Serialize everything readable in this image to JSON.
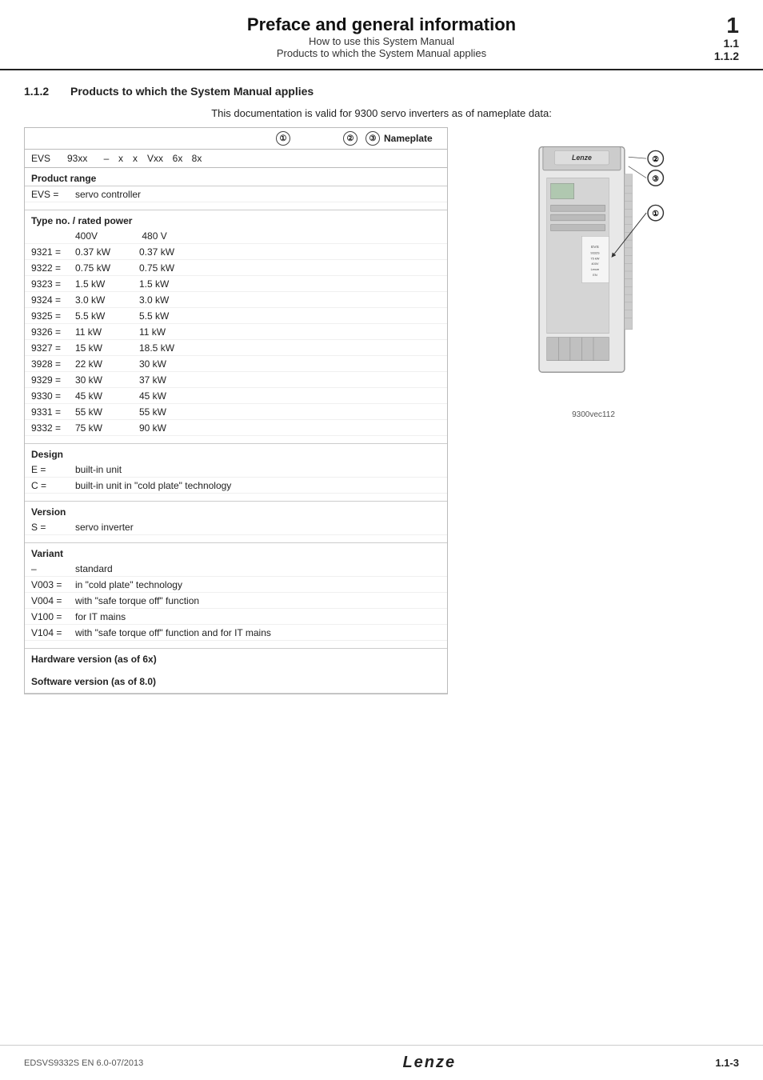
{
  "header": {
    "main_title": "Preface and general information",
    "sub1": "How to use this System Manual",
    "sub2": "Products to which the System Manual applies",
    "num_main": "1",
    "num_sub1": "1.1",
    "num_sub2": "1.1.2"
  },
  "section": {
    "number": "1.1.2",
    "title": "Products to which the System Manual applies",
    "description": "This documentation is valid for 9300 servo inverters as of nameplate data:"
  },
  "table": {
    "col_headers": {
      "circle1": "①",
      "circle2": "②",
      "circle3": "③",
      "nameplate": "Nameplate"
    },
    "evs_row": {
      "label": "EVS",
      "code93": "93xx",
      "dash": "–",
      "x1": "x",
      "x2": "x",
      "vxx": "Vxx",
      "num6x": "6x",
      "num8x": "8x"
    },
    "product_range_header": "Product range",
    "evs_desc": {
      "key": "EVS =",
      "value": "servo controller"
    },
    "type_power_header": "Type no. / rated power",
    "voltage_row": {
      "col1": "400V",
      "col2": "480 V"
    },
    "power_rows": [
      {
        "code": "9321 =",
        "val1": "0.37 kW",
        "val2": "0.37 kW"
      },
      {
        "code": "9322 =",
        "val1": "0.75 kW",
        "val2": "0.75 kW"
      },
      {
        "code": "9323 =",
        "val1": "1.5 kW",
        "val2": "1.5 kW"
      },
      {
        "code": "9324 =",
        "val1": "3.0 kW",
        "val2": "3.0 kW"
      },
      {
        "code": "9325 =",
        "val1": "5.5 kW",
        "val2": "5.5 kW"
      },
      {
        "code": "9326 =",
        "val1": "11 kW",
        "val2": "11 kW"
      },
      {
        "code": "9327 =",
        "val1": "15 kW",
        "val2": "18.5 kW"
      },
      {
        "code": "3928 =",
        "val1": "22 kW",
        "val2": "30 kW"
      },
      {
        "code": "9329 =",
        "val1": "30 kW",
        "val2": "37 kW"
      },
      {
        "code": "9330 =",
        "val1": "45 kW",
        "val2": "45 kW"
      },
      {
        "code": "9331 =",
        "val1": "55 kW",
        "val2": "55 kW"
      },
      {
        "code": "9332 =",
        "val1": "75 kW",
        "val2": "90 kW"
      }
    ],
    "design_header": "Design",
    "design_rows": [
      {
        "key": "E =",
        "value": "built-in unit"
      },
      {
        "key": "C =",
        "value": "built-in unit in \"cold plate\" technology"
      }
    ],
    "version_header": "Version",
    "version_rows": [
      {
        "key": "S =",
        "value": "servo inverter"
      }
    ],
    "variant_header": "Variant",
    "variant_rows": [
      {
        "key": "–",
        "value": "standard"
      },
      {
        "key": "V003 =",
        "value": "in \"cold plate\" technology"
      },
      {
        "key": "V004 =",
        "value": "with \"safe torque off\" function"
      },
      {
        "key": "V100 =",
        "value": "for IT mains"
      },
      {
        "key": "V104 =",
        "value": "with \"safe torque off\" function and for IT mains"
      }
    ],
    "hardware_header": "Hardware version (as of 6x)",
    "software_header": "Software version (as of 8.0)"
  },
  "device_image": {
    "caption": "9300vec112",
    "circle2_label": "②",
    "circle3_label": "③",
    "circle1_label": "①"
  },
  "footer": {
    "left": "EDSVS9332S  EN  6.0-07/2013",
    "center": "Lenze",
    "right": "1.1-3"
  }
}
